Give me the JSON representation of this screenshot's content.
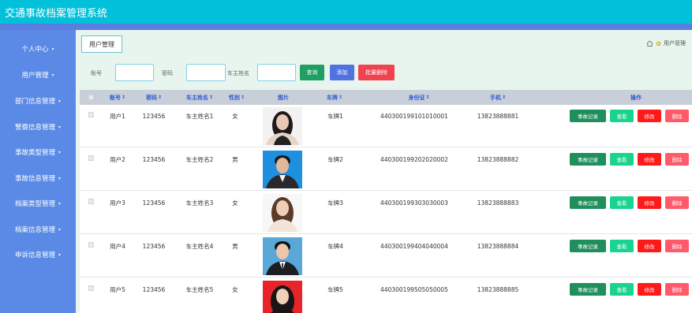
{
  "app": {
    "title": "交通事故档案管理系统"
  },
  "sidebar": {
    "items": [
      {
        "label": "个人中心"
      },
      {
        "label": "用户管理"
      },
      {
        "label": "部门信息管理"
      },
      {
        "label": "警察信息管理"
      },
      {
        "label": "事故类型管理"
      },
      {
        "label": "事故信息管理"
      },
      {
        "label": "档案类型管理"
      },
      {
        "label": "档案信息管理"
      },
      {
        "label": "申诉信息管理"
      }
    ]
  },
  "page": {
    "tab_label": "用户管理",
    "breadcrumb": "用户管理"
  },
  "search": {
    "account_label": "账号",
    "password_label": "密码",
    "owner_label": "车主姓名",
    "query_btn": "查询",
    "add_btn": "添加",
    "batch_delete_btn": "批量删除"
  },
  "table": {
    "headers": {
      "account": "账号",
      "password": "密码",
      "owner": "车主姓名",
      "gender": "性别",
      "photo": "图片",
      "plate": "车牌",
      "idcard": "身份证",
      "phone": "手机",
      "ops": "操作"
    },
    "action_labels": {
      "record": "事故记录",
      "view": "查看",
      "edit": "修改",
      "delete": "删除"
    },
    "rows": [
      {
        "account": "用户1",
        "password": "123456",
        "owner": "车主姓名1",
        "gender": "女",
        "plate": "车牌1",
        "idcard": "440300199101010001",
        "phone": "13823888881"
      },
      {
        "account": "用户2",
        "password": "123456",
        "owner": "车主姓名2",
        "gender": "男",
        "plate": "车牌2",
        "idcard": "440300199202020002",
        "phone": "13823888882"
      },
      {
        "account": "用户3",
        "password": "123456",
        "owner": "车主姓名3",
        "gender": "女",
        "plate": "车牌3",
        "idcard": "440300199303030003",
        "phone": "13823888883"
      },
      {
        "account": "用户4",
        "password": "123456",
        "owner": "车主姓名4",
        "gender": "男",
        "plate": "车牌4",
        "idcard": "440300199404040004",
        "phone": "13823888884"
      },
      {
        "account": "用户5",
        "password": "123456",
        "owner": "车主姓名5",
        "gender": "女",
        "plate": "车牌5",
        "idcard": "440300199505050005",
        "phone": "13823888885"
      }
    ]
  },
  "colors": {
    "topbar": "#00c0da",
    "sidebar": "#5a8ae6",
    "content_bg": "#e8f4ee",
    "query_btn": "#1f9f63",
    "add_btn": "#5173e0",
    "batch_delete_btn": "#f0434f",
    "record_btn": "#1f8f5c",
    "view_btn": "#19d38f",
    "edit_btn": "#ff1a1a",
    "delete_btn": "#ff5a6a"
  },
  "icons": [
    "home-icon",
    "star-icon",
    "chevron-down-icon",
    "sort-icon"
  ]
}
